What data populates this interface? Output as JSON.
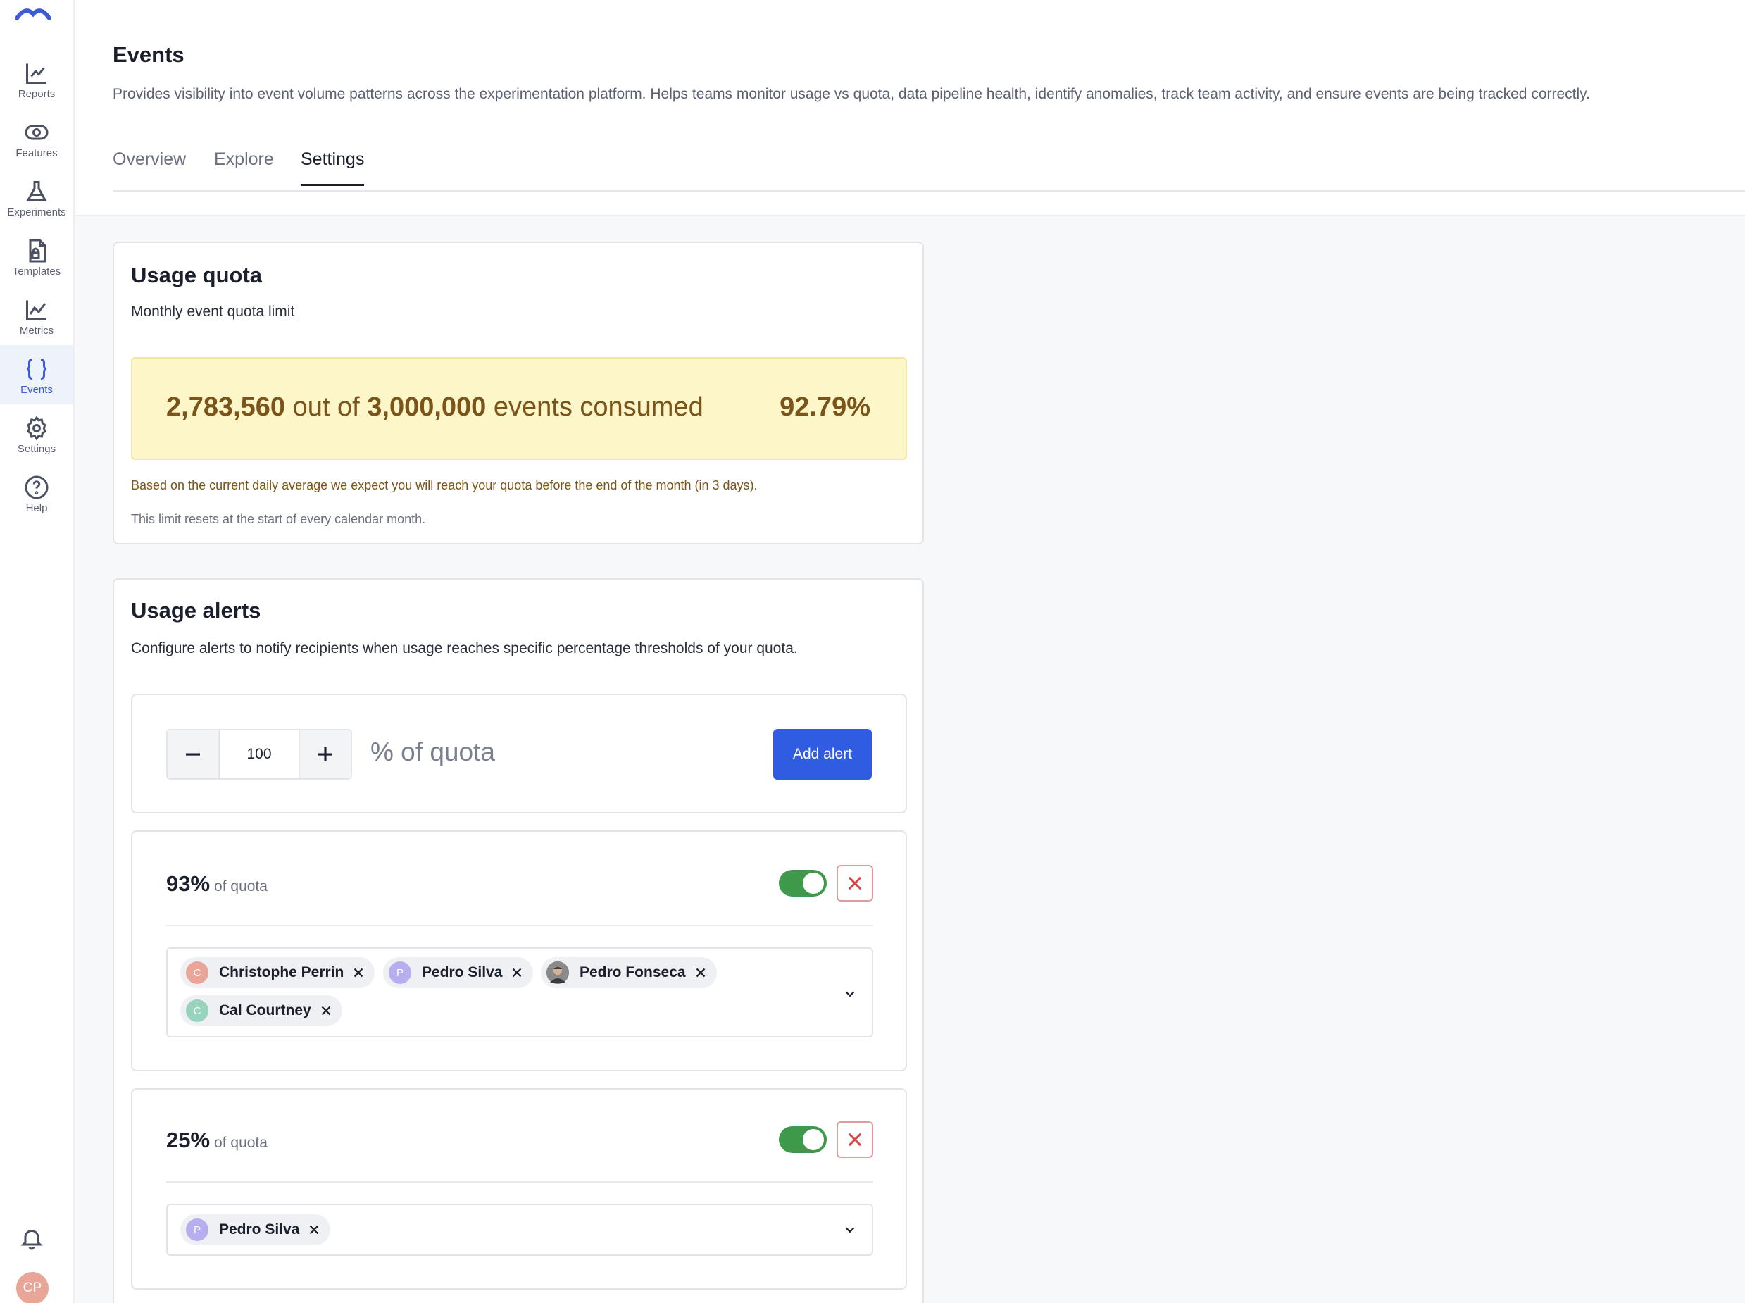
{
  "sidebar": {
    "items": [
      {
        "label": "Reports",
        "icon": "chart-icon"
      },
      {
        "label": "Features",
        "icon": "toggle-icon"
      },
      {
        "label": "Experiments",
        "icon": "flask-icon"
      },
      {
        "label": "Templates",
        "icon": "template-icon"
      },
      {
        "label": "Metrics",
        "icon": "line-chart-icon"
      },
      {
        "label": "Events",
        "icon": "braces-icon"
      },
      {
        "label": "Settings",
        "icon": "gear-icon"
      },
      {
        "label": "Help",
        "icon": "help-icon"
      }
    ],
    "active": "Events",
    "user_initials": "CP"
  },
  "header": {
    "title": "Events",
    "description": "Provides visibility into event volume patterns across the experimentation platform. Helps teams monitor usage vs quota, data pipeline health, identify anomalies, track team activity, and ensure events are being tracked correctly.",
    "tabs": [
      "Overview",
      "Explore",
      "Settings"
    ],
    "active_tab": "Settings"
  },
  "usage_quota": {
    "title": "Usage quota",
    "subtitle": "Monthly event quota limit",
    "consumed": "2,783,560",
    "out_of": "out of",
    "total": "3,000,000",
    "events_consumed": "events consumed",
    "percent": "92.79%",
    "forecast": "Based on the current daily average we expect you will reach your quota before the end of the month (in 3 days).",
    "reset_note": "This limit resets at the start of every calendar month."
  },
  "usage_alerts": {
    "title": "Usage alerts",
    "subtitle": "Configure alerts to notify recipients when usage reaches specific percentage thresholds of your quota.",
    "new_alert": {
      "value": "100",
      "suffix": "% of quota",
      "add_label": "Add alert"
    },
    "alerts": [
      {
        "percent": "93%",
        "of_label": "of quota",
        "enabled": true,
        "recipients": [
          {
            "name": "Christophe Perrin",
            "initial": "C",
            "color": "#e8a598"
          },
          {
            "name": "Pedro Silva",
            "initial": "P",
            "color": "#b7aef0"
          },
          {
            "name": "Pedro Fonseca",
            "initial": "",
            "color": "#6b6b6b"
          },
          {
            "name": "Cal Courtney",
            "initial": "C",
            "color": "#97d3bd"
          }
        ]
      },
      {
        "percent": "25%",
        "of_label": "of quota",
        "enabled": true,
        "recipients": [
          {
            "name": "Pedro Silva",
            "initial": "P",
            "color": "#b7aef0"
          }
        ]
      }
    ]
  },
  "colors": {
    "accent": "#2f5ce0",
    "toggle_on": "#3e9a4a",
    "warning_bg": "#fdf6c8",
    "warning_text": "#7a5419",
    "danger": "#d64545"
  }
}
